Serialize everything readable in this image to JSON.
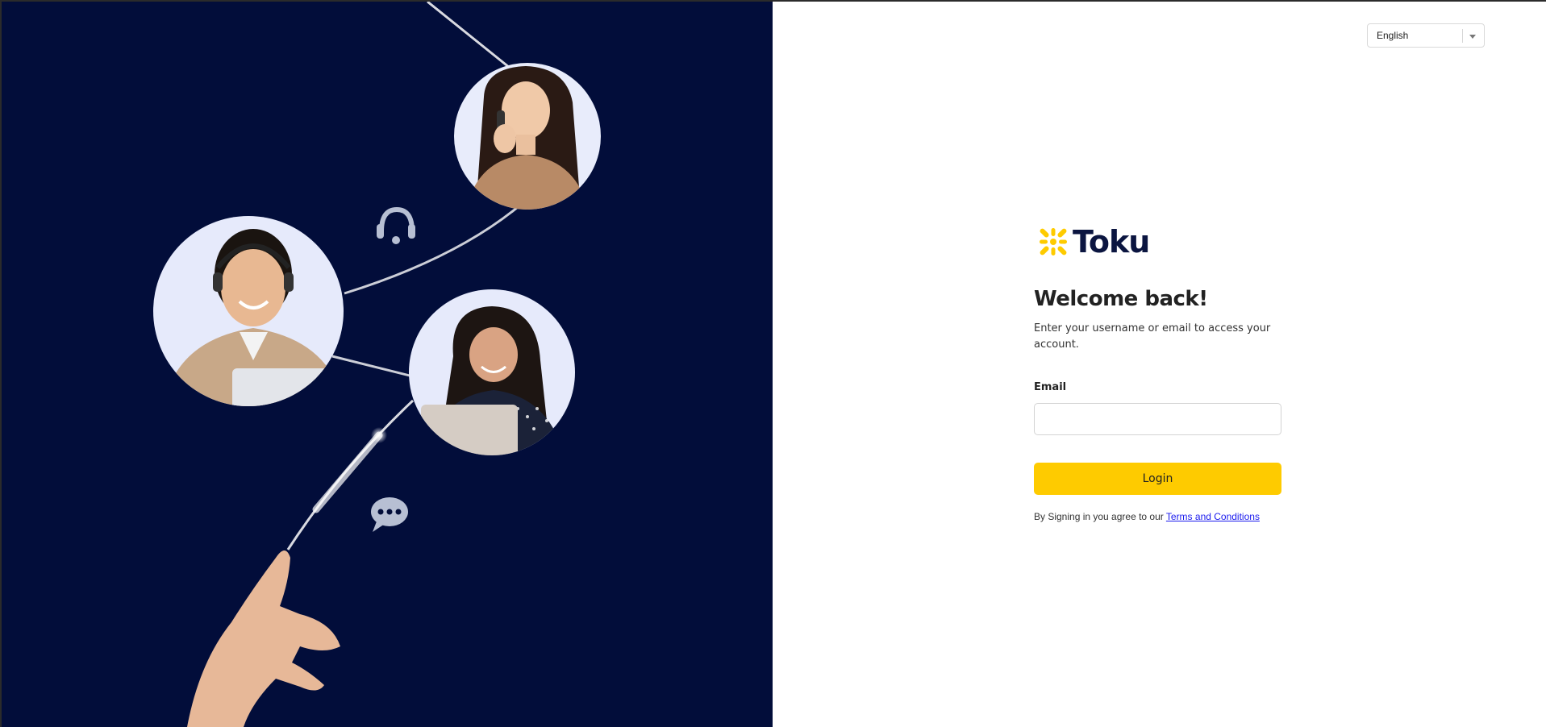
{
  "language_select": {
    "selected": "English",
    "icon": "chevron-down-icon"
  },
  "brand": {
    "name": "Toku",
    "logo_icon": "toku-cross-logo-icon",
    "colors": {
      "accent": "#fecb00",
      "navy": "#020d3a"
    }
  },
  "login": {
    "heading": "Welcome back!",
    "subtitle": "Enter your username or email to access your account.",
    "email_label": "Email",
    "email_value": "",
    "email_placeholder": "",
    "button_label": "Login",
    "terms_prefix": "By Signing in you agree to our ",
    "terms_link": "Terms and Conditions"
  },
  "hero": {
    "icons": [
      "headset-icon",
      "chat-bubble-icon"
    ]
  }
}
